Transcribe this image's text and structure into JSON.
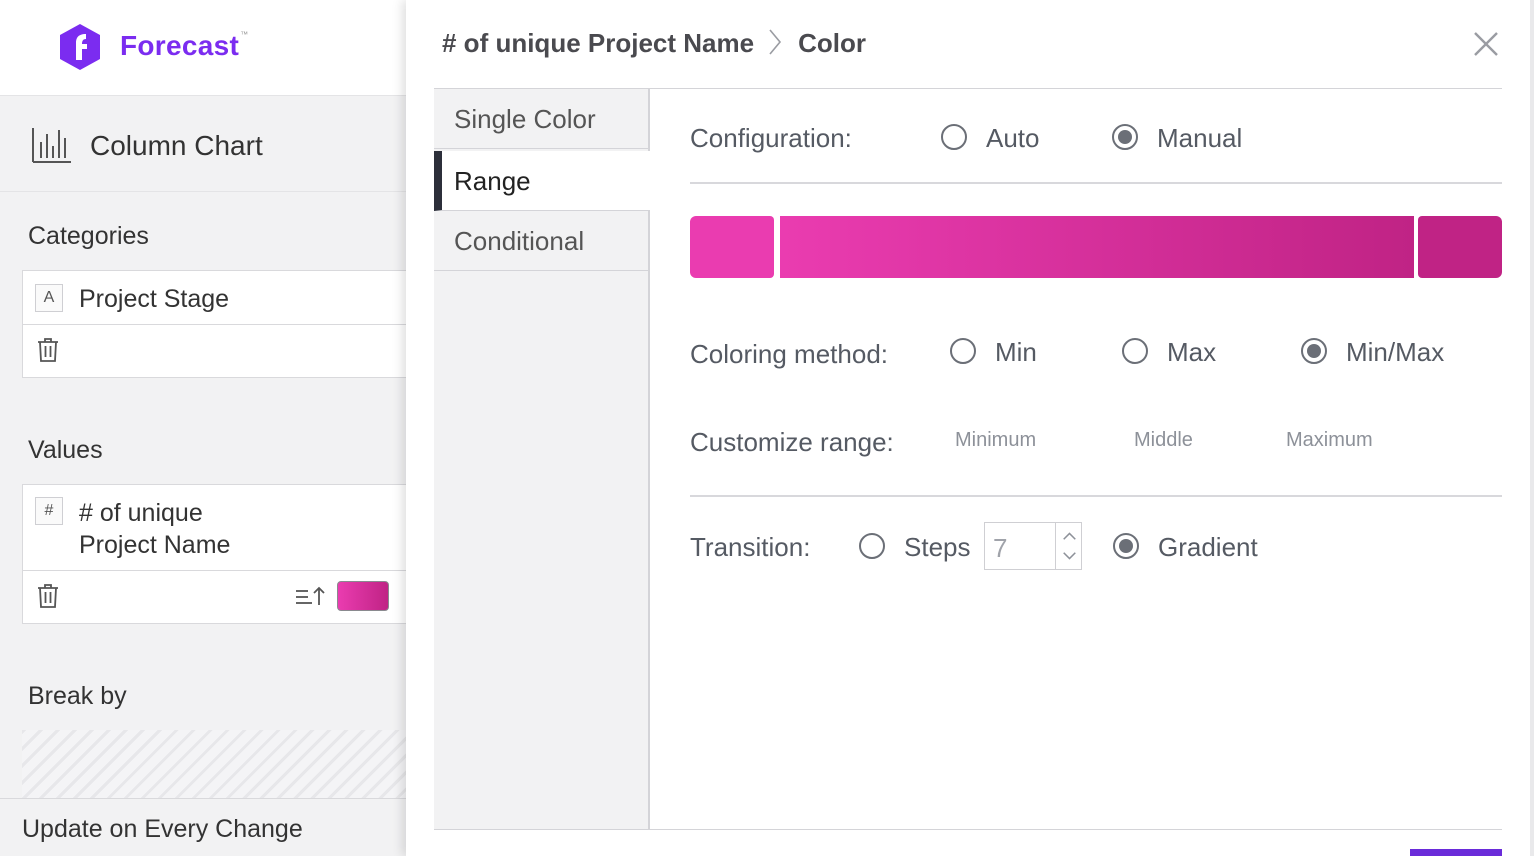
{
  "brand": {
    "name": "Forecast",
    "trademark": "™",
    "color": "#7b2cf0"
  },
  "left_panel": {
    "chart_type": {
      "label": "Column Chart",
      "icon": "column-chart-icon"
    },
    "categories": {
      "title": "Categories",
      "field": {
        "type_badge": "A",
        "label": "Project Stage"
      }
    },
    "values": {
      "title": "Values",
      "field": {
        "type_badge": "#",
        "label_line1": "# of unique",
        "label_line2": "Project Name",
        "swatch_color": "#e03aa8"
      }
    },
    "break_by": {
      "title": "Break by"
    },
    "update_label": "Update on Every Change"
  },
  "modal": {
    "breadcrumb": {
      "part1": "# of unique Project Name",
      "part2": "Color"
    },
    "tabs": [
      {
        "label": "Single Color",
        "active": false
      },
      {
        "label": "Range",
        "active": true
      },
      {
        "label": "Conditional",
        "active": false
      }
    ],
    "configuration": {
      "label": "Configuration:",
      "options": [
        {
          "label": "Auto",
          "checked": false
        },
        {
          "label": "Manual",
          "checked": true
        }
      ]
    },
    "gradient": {
      "start_color": "#ea3cb0",
      "end_color": "#c02385"
    },
    "coloring_method": {
      "label": "Coloring method:",
      "options": [
        {
          "label": "Min",
          "checked": false
        },
        {
          "label": "Max",
          "checked": false
        },
        {
          "label": "Min/Max",
          "checked": true
        }
      ]
    },
    "customize_range": {
      "label": "Customize range:",
      "placeholders": {
        "minimum": "Minimum",
        "middle": "Middle",
        "maximum": "Maximum"
      }
    },
    "transition": {
      "label": "Transition:",
      "steps_label": "Steps",
      "steps_value": "7",
      "steps_checked": false,
      "gradient_label": "Gradient",
      "gradient_checked": true
    }
  }
}
